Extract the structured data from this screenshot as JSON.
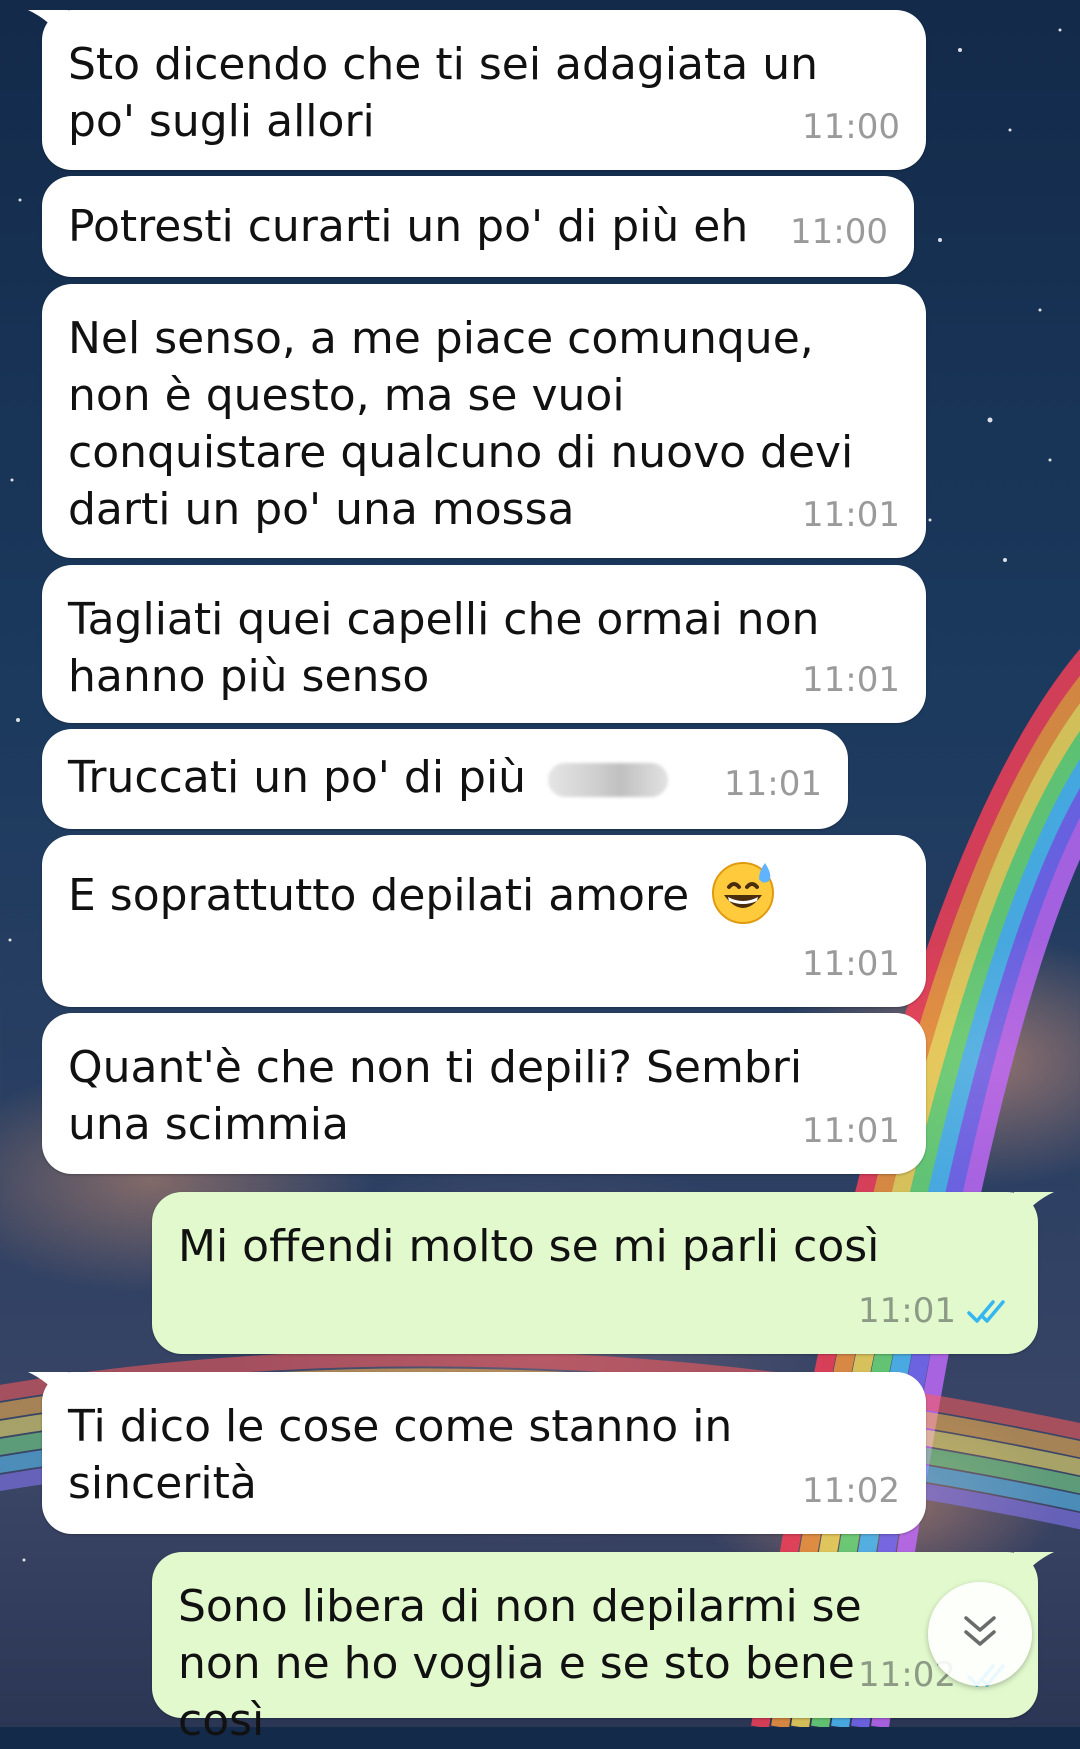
{
  "colors": {
    "incoming_bubble": "#ffffff",
    "outgoing_bubble": "#e1f9cd",
    "timestamp": "#9a9a9a",
    "read_ticks": "#34b7f1"
  },
  "messages": [
    {
      "direction": "in",
      "text": "Sto dicendo che ti sei adagiata un po' sugli allori",
      "time": "11:00"
    },
    {
      "direction": "in",
      "text": "Potresti curarti un po' di più eh",
      "time": "11:00"
    },
    {
      "direction": "in",
      "text": "Nel senso, a me piace comunque, non è questo, ma se vuoi conquistare qualcuno di nuovo devi darti un po' una mossa",
      "time": "11:01"
    },
    {
      "direction": "in",
      "text": "Tagliati quei capelli che ormai non hanno più senso",
      "time": "11:01"
    },
    {
      "direction": "in",
      "text": "Truccati un po' di più",
      "time": "11:01",
      "attachment": "blurred-redaction"
    },
    {
      "direction": "in",
      "text": "E soprattutto depilati amore",
      "time": "11:01",
      "emoji": "grinning-sweat-emoji"
    },
    {
      "direction": "in",
      "text": "Quant'è che non ti depili? Sembri una scimmia",
      "time": "11:01"
    },
    {
      "direction": "out",
      "text": "Mi offendi molto se mi parli così",
      "time": "11:01",
      "status": "read-double-check-icon"
    },
    {
      "direction": "in",
      "text": "Ti dico le cose come stanno in sincerità",
      "time": "11:02"
    },
    {
      "direction": "out",
      "text": "Sono libera di non depilarmi se non ne ho voglia e se sto bene così",
      "time": "11:02",
      "status": "read-double-check-icon"
    }
  ],
  "scroll_button": {
    "icon": "double-chevron-down-icon"
  }
}
